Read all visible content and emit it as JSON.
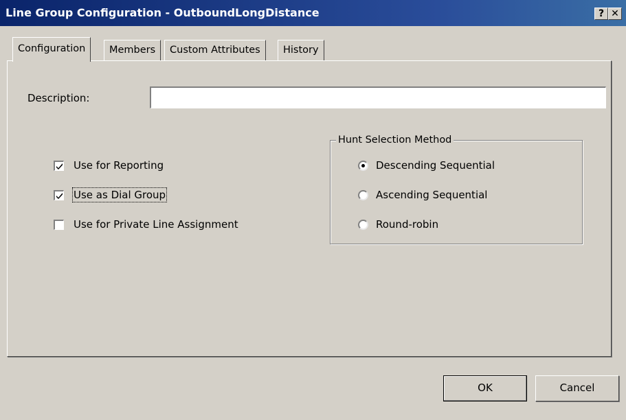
{
  "window": {
    "title": "Line Group Configuration - OutboundLongDistance",
    "help_label": "?",
    "close_label": "✕"
  },
  "tabs": [
    {
      "label": "Configuration",
      "active": true
    },
    {
      "label": "Members",
      "active": false
    },
    {
      "label": "Custom Attributes",
      "active": false
    },
    {
      "label": "History",
      "active": false
    }
  ],
  "description": {
    "label": "Description:",
    "value": ""
  },
  "checkboxes": [
    {
      "label": "Use for Reporting",
      "checked": true
    },
    {
      "label": "Use as Dial Group",
      "checked": true
    },
    {
      "label": "Use for Private Line Assignment",
      "checked": false
    }
  ],
  "hunt_selection": {
    "title": "Hunt Selection Method",
    "options": [
      {
        "label": "Descending Sequential",
        "selected": true
      },
      {
        "label": "Ascending Sequential",
        "selected": false
      },
      {
        "label": "Round-robin",
        "selected": false
      }
    ]
  },
  "buttons": {
    "ok_label": "OK",
    "cancel_label": "Cancel"
  }
}
